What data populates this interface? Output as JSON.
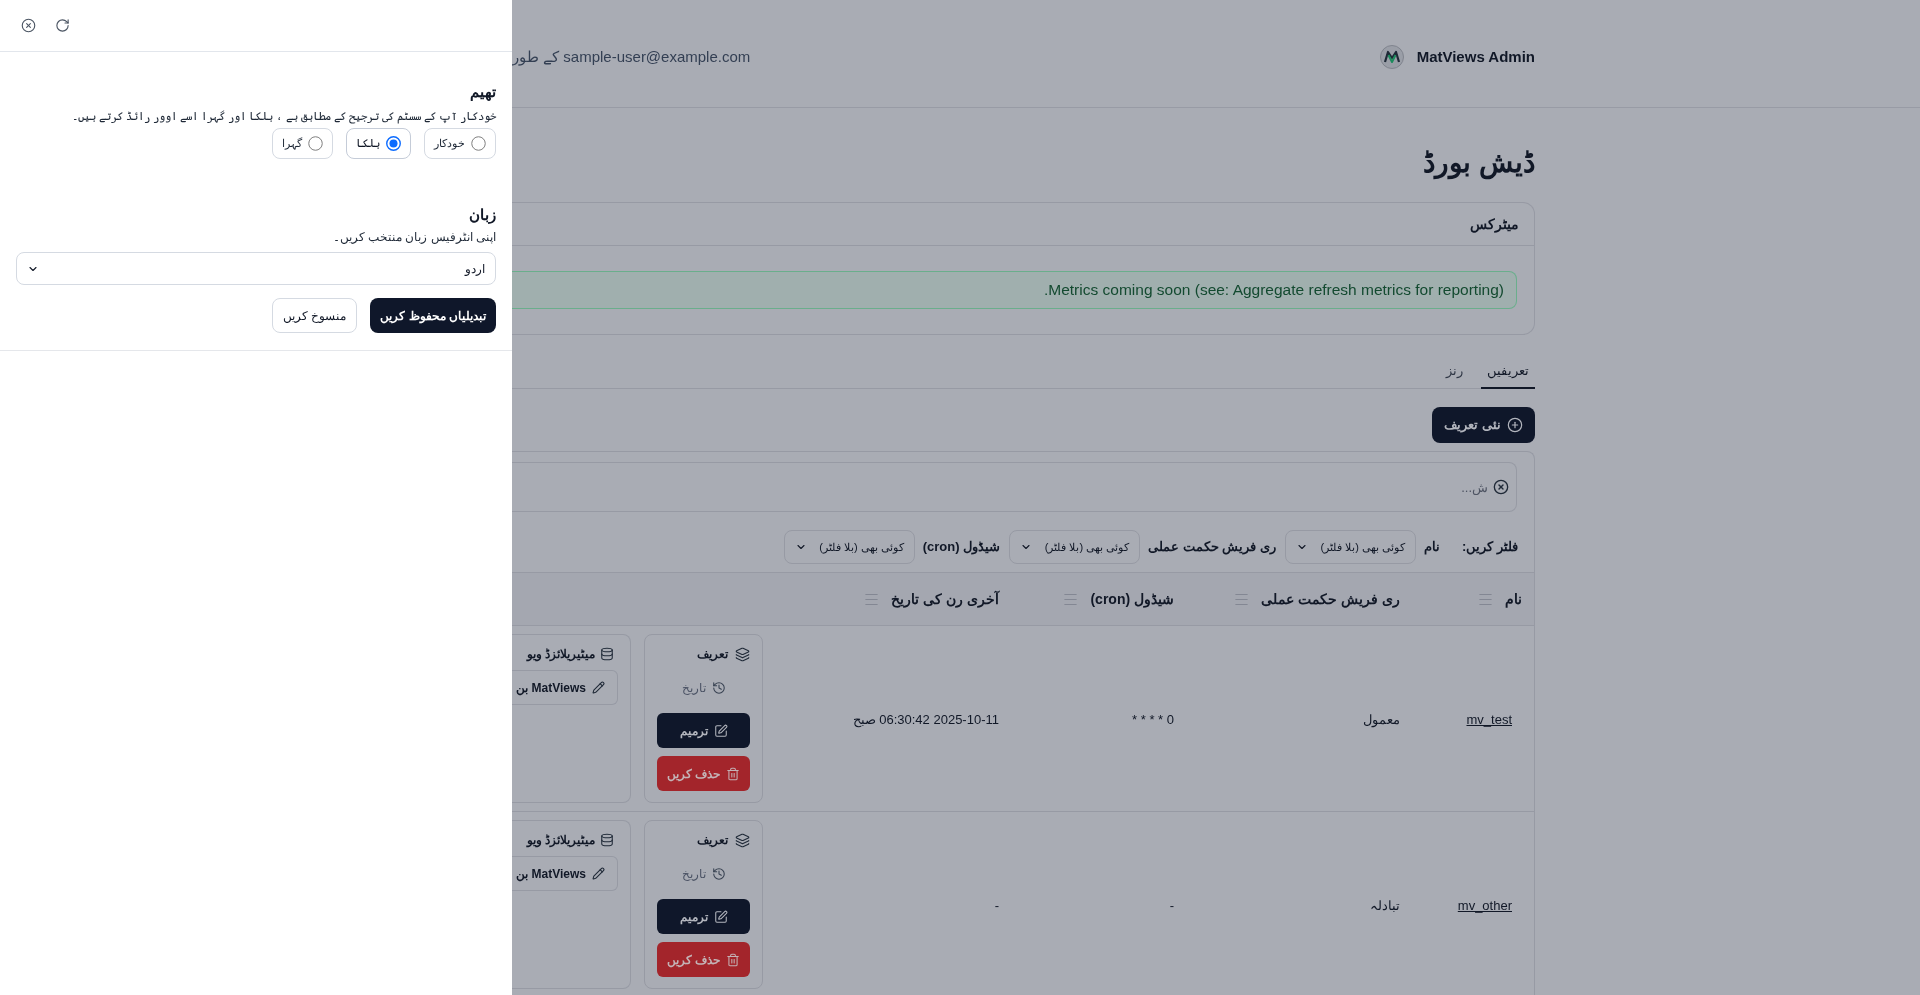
{
  "settings_drawer": {
    "theme": {
      "title": "تھیم",
      "description": "خودکار آپ کے سسٹم کی ترجیح کے مطابق ہے ، ہلکا اور گہرا اسے اوور رائڈ کرتے ہیں۔",
      "options": [
        {
          "label": "خودکار",
          "selected": false
        },
        {
          "label": "ہلکا",
          "selected": true
        },
        {
          "label": "گہرا",
          "selected": false
        }
      ]
    },
    "language": {
      "title": "زبان",
      "description": "اپنی انٹرفیس زبان منتخب کریں۔",
      "value": "اردو"
    },
    "buttons": [
      {
        "label": "تبدیلیاں محفوظ کریں",
        "kind": "primary"
      },
      {
        "label": "منسوخ کریں",
        "kind": "secondary"
      }
    ]
  },
  "header": {
    "app_name": "MatViews Admin",
    "user_text": "sample-user@example.com کے طور"
  },
  "title": "ڈیش بورڈ",
  "metrics": {
    "title": "میٹرکس",
    "notice": "Metrics coming soon (see: Aggregate refresh metrics for reporting)."
  },
  "tabs": [
    {
      "label": "تعریفیں",
      "selected": true
    },
    {
      "label": "رنز",
      "selected": false
    }
  ],
  "new_button": "نئی تعریف",
  "search": {
    "placeholder": "ش..."
  },
  "filters": {
    "label": "فلٹر کریں:",
    "items": [
      {
        "label": "نام",
        "value": "کوئی بھی (بلا فلٹر)"
      },
      {
        "label": "ری فریش حکمت عملی",
        "value": "کوئی بھی (بلا فلٹر)"
      },
      {
        "label": "شیڈول (cron)",
        "value": "کوئی بھی (بلا فلٹر)"
      }
    ]
  },
  "table": {
    "columns": [
      "نام",
      "ری فریش حکمت عملی",
      "شیڈول (cron)",
      "آخری رن کی تاریخ"
    ],
    "rows": [
      {
        "name": "mv_test",
        "refresh_strategy": "معمول",
        "schedule": "0 * * * *",
        "last_run": "2025-10-11 06:30:42 صبح",
        "column_5": [
          {
            "kind": "title",
            "label": "تعریف"
          },
          {
            "kind": "history",
            "label": "تاریخ"
          },
          {
            "kind": "edit",
            "label": "ترمیم"
          },
          {
            "kind": "delete",
            "label": "حذف کریں"
          }
        ],
        "column_6": {
          "title": "میٹیریلائزڈ ویو",
          "button": "MatViews بن"
        }
      },
      {
        "name": "mv_other",
        "refresh_strategy": "تبادلہ",
        "schedule": "-",
        "last_run": "-",
        "column_5": [
          {
            "kind": "title",
            "label": "تعریف"
          },
          {
            "kind": "history",
            "label": "تاریخ"
          },
          {
            "kind": "edit",
            "label": "ترمیم"
          },
          {
            "kind": "delete",
            "label": "حذف کریں"
          }
        ],
        "column_6": {
          "title": "میٹیریلائزڈ ویو",
          "button": "MatViews بن"
        }
      }
    ]
  }
}
